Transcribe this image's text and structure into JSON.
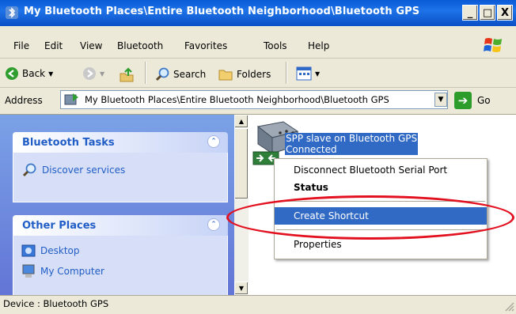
{
  "window": {
    "title": "My Bluetooth Places\\Entire Bluetooth Neighborhood\\Bluetooth GPS",
    "minimize": "_",
    "maximize": "□",
    "close": "X"
  },
  "menubar": {
    "items": [
      {
        "label": "File"
      },
      {
        "label": "Edit"
      },
      {
        "label": "View"
      },
      {
        "label": "Bluetooth"
      },
      {
        "label": "Favorites"
      },
      {
        "label": "Tools"
      },
      {
        "label": "Help"
      }
    ]
  },
  "toolbar": {
    "back_label": "Back",
    "search_label": "Search",
    "folders_label": "Folders"
  },
  "address": {
    "label": "Address",
    "value": "My Bluetooth Places\\Entire Bluetooth Neighborhood\\Bluetooth GPS",
    "go_label": "Go"
  },
  "sidebar": {
    "bluetooth_tasks": {
      "title": "Bluetooth Tasks",
      "items": [
        {
          "label": "Discover services",
          "icon": "magnifier-icon"
        }
      ]
    },
    "other_places": {
      "title": "Other Places",
      "items": [
        {
          "label": "Desktop",
          "icon": "desktop-icon"
        },
        {
          "label": "My Computer",
          "icon": "computer-icon"
        }
      ]
    }
  },
  "content": {
    "device": {
      "name": "SPP slave on Bluetooth GPS",
      "status": "Connected",
      "icon": "serial-port-icon"
    }
  },
  "context_menu": {
    "items": [
      {
        "label": "Disconnect Bluetooth Serial Port"
      },
      {
        "label": "Status"
      },
      {
        "label": "Create Shortcut"
      },
      {
        "label": "Properties"
      }
    ]
  },
  "status_bar": {
    "text": "Device : Bluetooth GPS"
  },
  "colors": {
    "title_bar": "#0a5ad6",
    "selection": "#316ac5",
    "annotation_ellipse": "#e3101f",
    "panel_title": "#215dc6"
  }
}
